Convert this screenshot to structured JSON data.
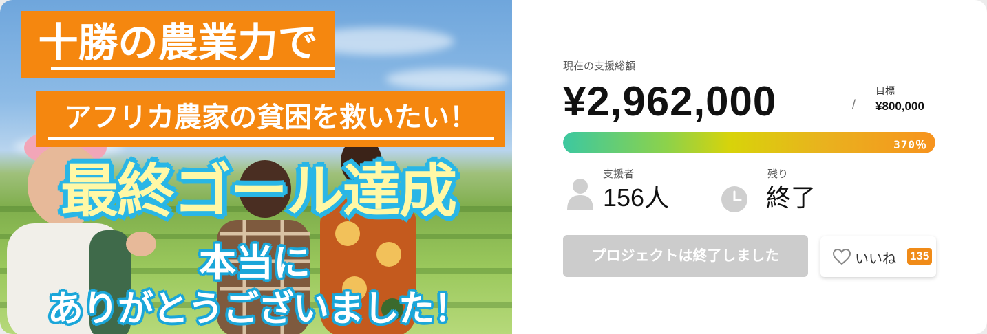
{
  "hero": {
    "banner_line1": "十勝の農業力で",
    "banner_line2": "アフリカ農家の貧困を救いたい！",
    "goal_achieved": "最終ゴール達成",
    "thanks_line1": "本当に",
    "thanks_line2": "ありがとうございました！"
  },
  "funding": {
    "current_label": "現在の支援総額",
    "current_amount": "¥2,962,000",
    "goal_separator": "/",
    "goal_label": "目標",
    "goal_amount": "¥800,000",
    "progress_percent_text": "370％",
    "progress_fraction": 1.0
  },
  "stats": {
    "supporters_label": "支援者",
    "supporters_value": "156人",
    "remaining_label": "残り",
    "remaining_value": "終了"
  },
  "actions": {
    "ended_button_label": "プロジェクトは終了しました",
    "like_label": "いいね",
    "like_count": "135"
  },
  "icons": {
    "supporters": "user-icon",
    "remaining": "clock-icon",
    "like": "heart-icon"
  },
  "colors": {
    "banner_orange": "#f5870f",
    "goal_text_yellow": "#fff8a6",
    "goal_outline_blue": "#29b6e6",
    "like_badge": "#f08b18",
    "button_disabled": "#cccccc"
  }
}
